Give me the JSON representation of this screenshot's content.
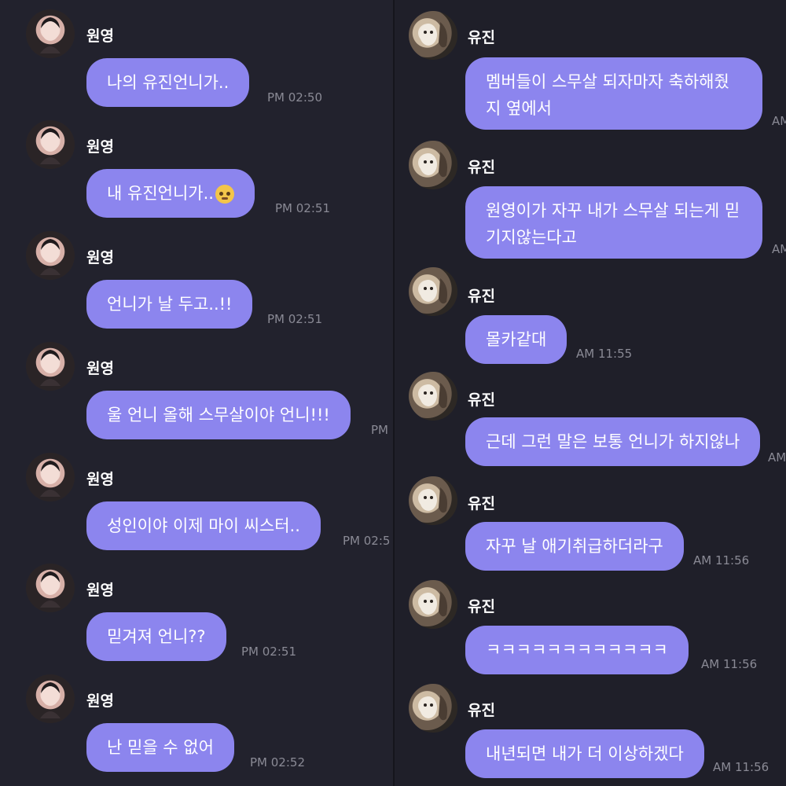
{
  "left_column": {
    "messages": [
      {
        "sender": "원영",
        "text": "나의 유진언니가..",
        "time": "PM 02:50"
      },
      {
        "sender": "원영",
        "text": "내 유진언니가..",
        "emoji": "rolling-eyes-emoji",
        "time": "PM 02:51"
      },
      {
        "sender": "원영",
        "text": "언니가 날 두고..!!",
        "time": "PM 02:51"
      },
      {
        "sender": "원영",
        "text": "울 언니 올해 스무살이야 언니!!!",
        "time": "PM"
      },
      {
        "sender": "원영",
        "text": "성인이야 이제 마이 씨스터..",
        "time": "PM 02:5"
      },
      {
        "sender": "원영",
        "text": "믿겨져 언니??",
        "time": "PM 02:51"
      },
      {
        "sender": "원영",
        "text": "난 믿을 수 없어",
        "time": "PM 02:52"
      }
    ]
  },
  "right_column": {
    "messages": [
      {
        "sender": "유진",
        "text": "멤버들이 스무살 되자마자 축하해줬지 옆에서",
        "time": "AM"
      },
      {
        "sender": "유진",
        "text": "원영이가 자꾸 내가 스무살 되는게 믿기지않는다고",
        "time": "AM"
      },
      {
        "sender": "유진",
        "text": "몰카같대",
        "time": "AM 11:55"
      },
      {
        "sender": "유진",
        "text": "근데 그런 말은 보통 언니가 하지않나",
        "time": "AM"
      },
      {
        "sender": "유진",
        "text": "자꾸 날 애기취급하더라구",
        "time": "AM 11:56"
      },
      {
        "sender": "유진",
        "text": "ㅋㅋㅋㅋㅋㅋㅋㅋㅋㅋㅋㅋ",
        "time": "AM 11:56"
      },
      {
        "sender": "유진",
        "text": "내년되면 내가 더 이상하겠다",
        "time": "AM 11:56"
      }
    ]
  },
  "colors": {
    "background_left": "#22222d",
    "background_right": "#1f1f29",
    "bubble": "#8c85ee",
    "text": "#ffffff",
    "timestamp": "#8a8a95"
  }
}
